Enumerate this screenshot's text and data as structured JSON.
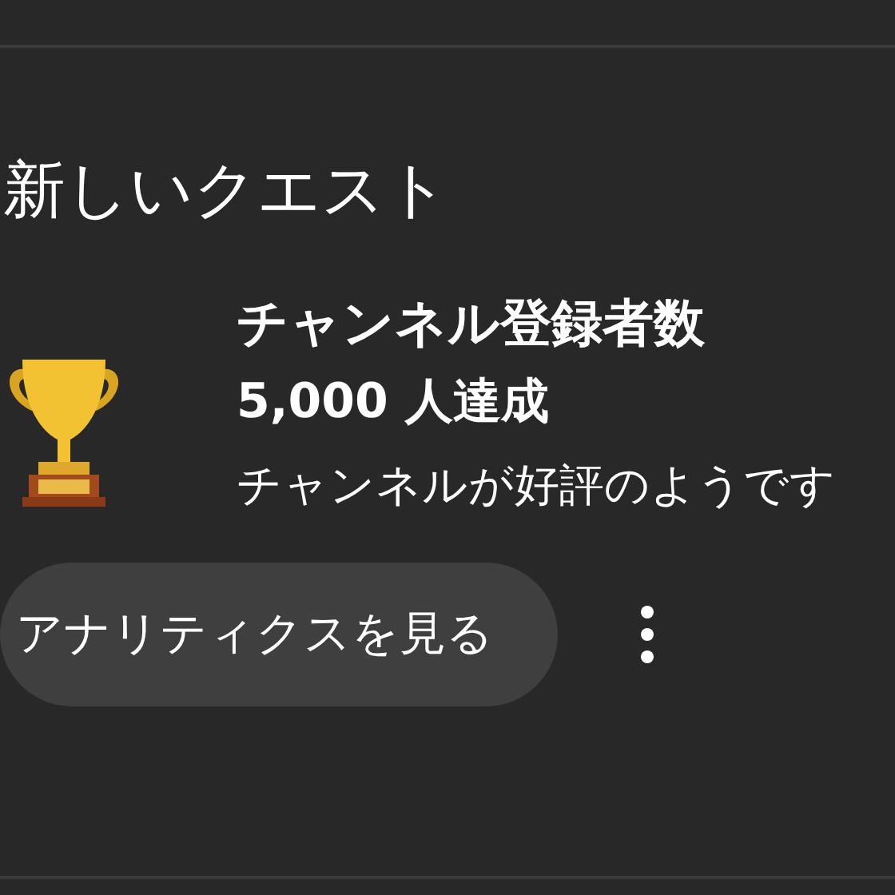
{
  "section": {
    "title": "新しいクエスト"
  },
  "quest": {
    "title": "チャンネル登録者数",
    "milestone": "5,000 人達成",
    "description": "チャンネルが好評のようです"
  },
  "actions": {
    "primary_button": "アナリティクスを見る"
  }
}
